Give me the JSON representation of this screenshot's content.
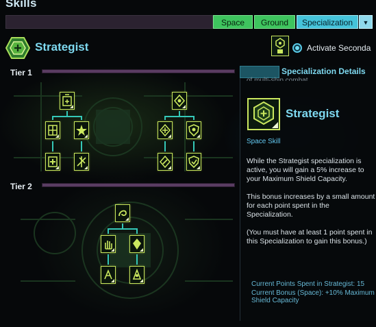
{
  "header": {
    "title": "Skills",
    "tabs": [
      {
        "label": "Space"
      },
      {
        "label": "Ground"
      },
      {
        "label": "Specialization"
      }
    ],
    "dropdown_icon": "triangle-down-icon"
  },
  "specialization": {
    "name": "Strategist",
    "icon": "strategist-hex-icon",
    "activate_secondary_label": "Activate Seconda"
  },
  "tiers": [
    {
      "label": "Tier 1"
    },
    {
      "label": "Tier 2"
    }
  ],
  "details": {
    "header": "Specialization Details",
    "clipped_text": "of multi-ship combat.",
    "name": "Strategist",
    "type": "Space Skill",
    "paragraphs": [
      "While the Strategist specialization is active, you will gain a 5% increase to your Maximum Shield Capacity.",
      "This bonus increases by a small amount for each point spent in the Specialization.",
      "(You must have at least 1 point spent in this Specialization to gain this bonus.)"
    ],
    "points_spent": "Current Points Spent in Strategist: 15",
    "current_bonus": "Current Bonus (Space): +10% Maximum Shield Capacity"
  },
  "colors": {
    "accent_cyan": "#7ed9f0",
    "tab_green": "#3ec45e",
    "tab_active": "#45c3da",
    "node_border": "#c8e65c",
    "link": "#35c8b8"
  }
}
